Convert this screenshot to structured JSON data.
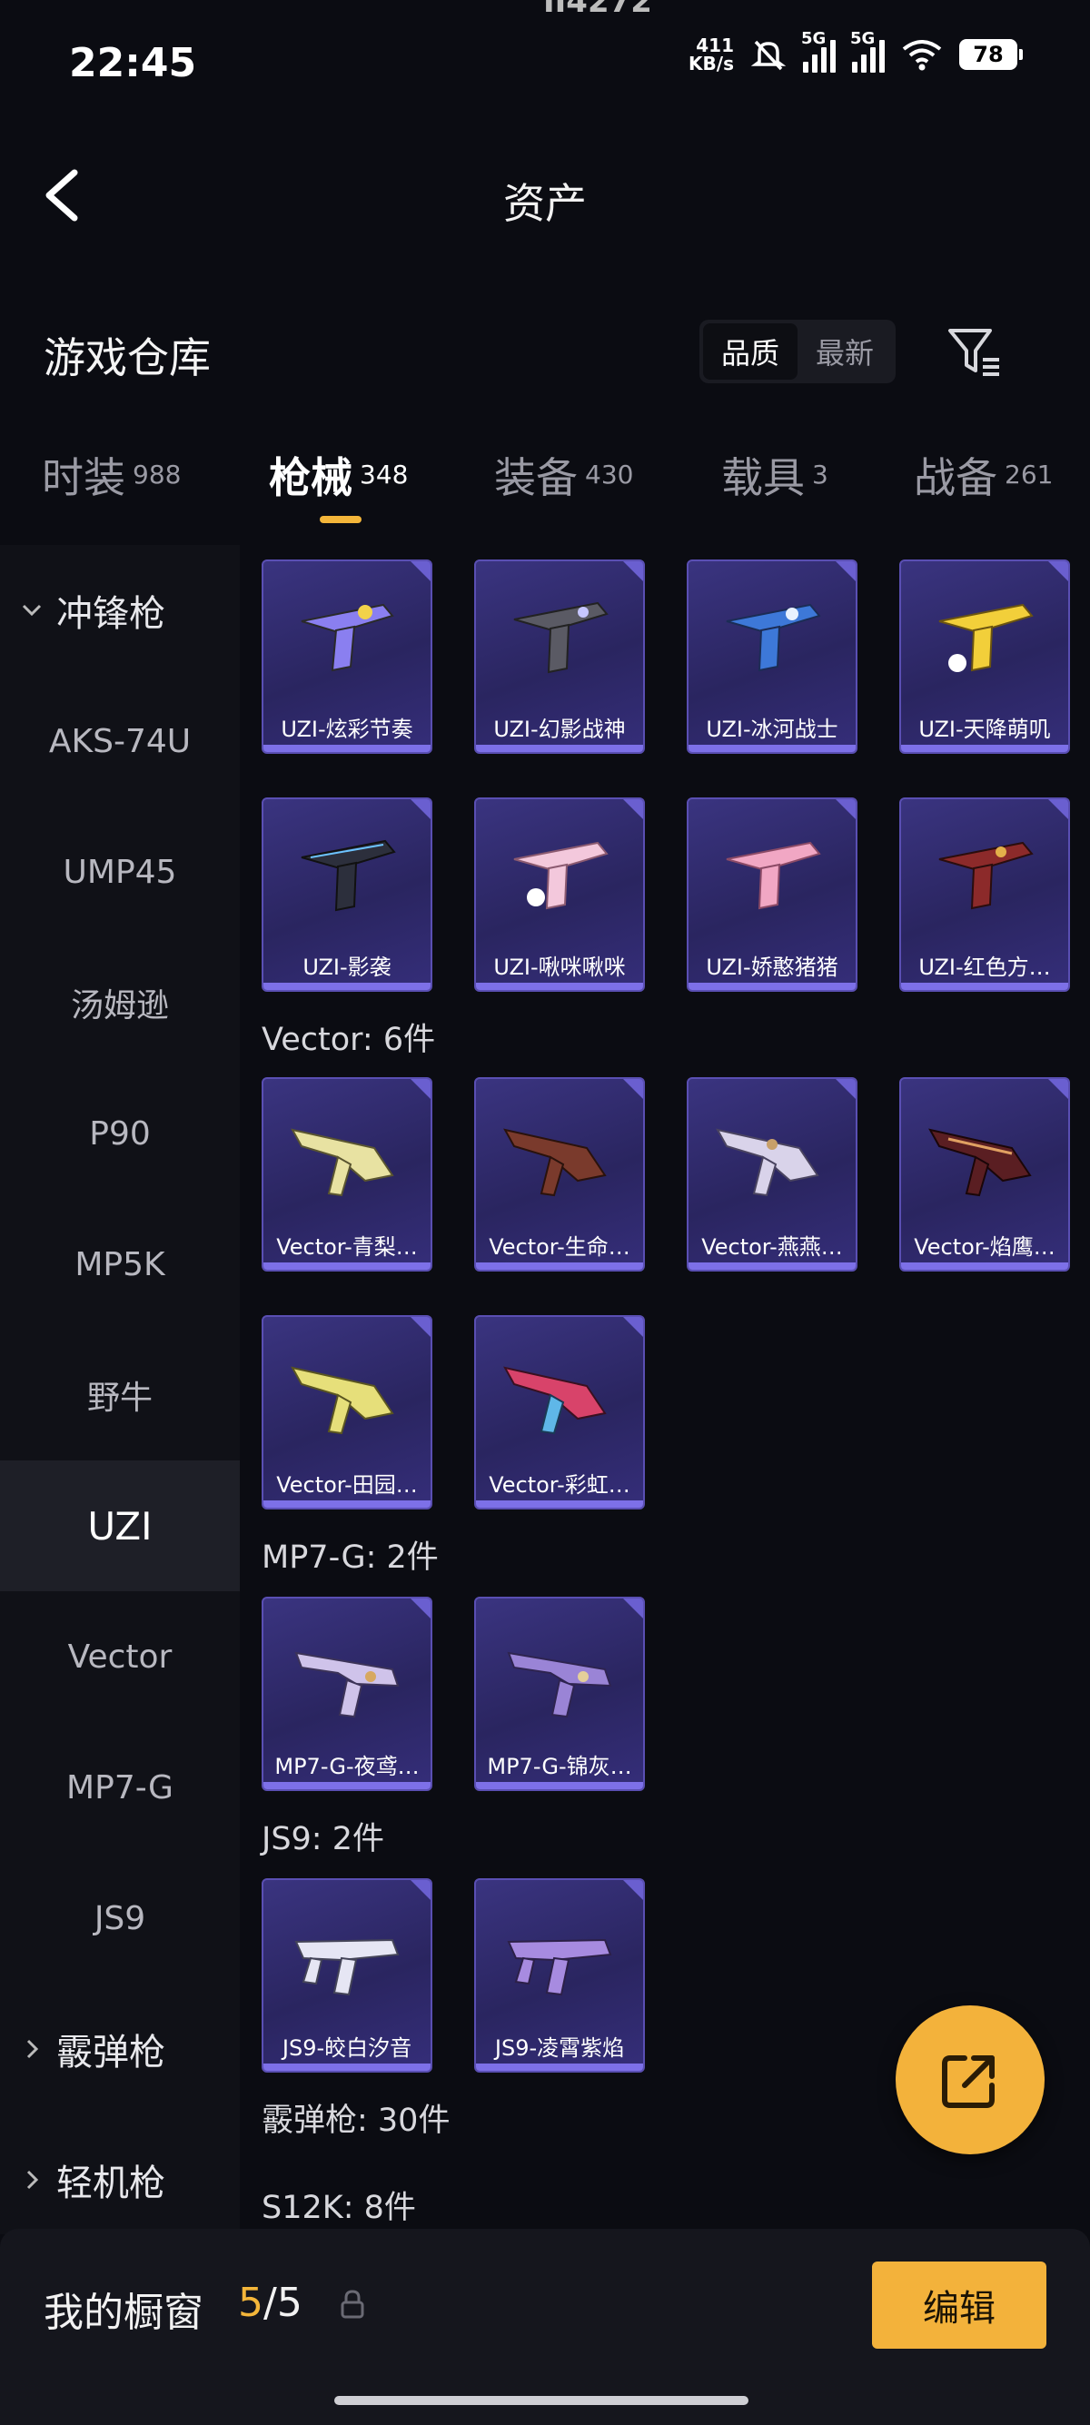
{
  "status": {
    "time": "22:45",
    "top_cut_text": "II4272",
    "net_speed_value": "411",
    "net_speed_unit": "KB/s",
    "sim1": "5G",
    "sim2": "5G",
    "battery": "78"
  },
  "header": {
    "title": "资产"
  },
  "warehouse": {
    "title": "游戏仓库",
    "sort_options": [
      "品质",
      "最新"
    ],
    "active_sort": "品质"
  },
  "tabs": [
    {
      "label": "时装",
      "count": "988"
    },
    {
      "label": "枪械",
      "count": "348",
      "active": true
    },
    {
      "label": "装备",
      "count": "430"
    },
    {
      "label": "载具",
      "count": "3"
    },
    {
      "label": "战备",
      "count": "261"
    }
  ],
  "sidebar": {
    "group_open": "冲锋枪",
    "items": [
      "AKS-74U",
      "UMP45",
      "汤姆逊",
      "P90",
      "MP5K",
      "野牛",
      "UZI",
      "Vector",
      "MP7-G",
      "JS9"
    ],
    "selected": "UZI",
    "groups_closed": [
      "霰弹枪",
      "轻机枪"
    ]
  },
  "grid": {
    "uzi_items": [
      "UZI-炫彩节奏",
      "UZI-幻影战神",
      "UZI-冰河战士",
      "UZI-天降萌叽",
      "UZI-影袭",
      "UZI-啾咪啾咪",
      "UZI-娇憨猪猪",
      "UZI-红色方…"
    ],
    "vector_header": "Vector: 6件",
    "vector_items": [
      "Vector-青梨…",
      "Vector-生命…",
      "Vector-燕燕…",
      "Vector-焰鹰…",
      "Vector-田园…",
      "Vector-彩虹…"
    ],
    "mp7_header": "MP7-G: 2件",
    "mp7_items": [
      "MP7-G-夜鸢…",
      "MP7-G-锦灰…"
    ],
    "js9_header": "JS9: 2件",
    "js9_items": [
      "JS9-皎白汐音",
      "JS9-凌霄紫焰"
    ],
    "shotgun_header": "霰弹枪: 30件",
    "s12k_header": "S12K: 8件"
  },
  "showcase": {
    "label": "我的橱窗",
    "current": "5",
    "sep_total": "/5",
    "edit": "编辑"
  },
  "colors": {
    "accent": "#f3b23b",
    "card_bg": "#2f2a6e",
    "card_border": "#5a4fb3",
    "background": "#0b0c12"
  },
  "icons": {
    "back": "chevron-left-icon",
    "filter": "filter-icon",
    "share": "share-icon",
    "lock": "lock-icon"
  }
}
